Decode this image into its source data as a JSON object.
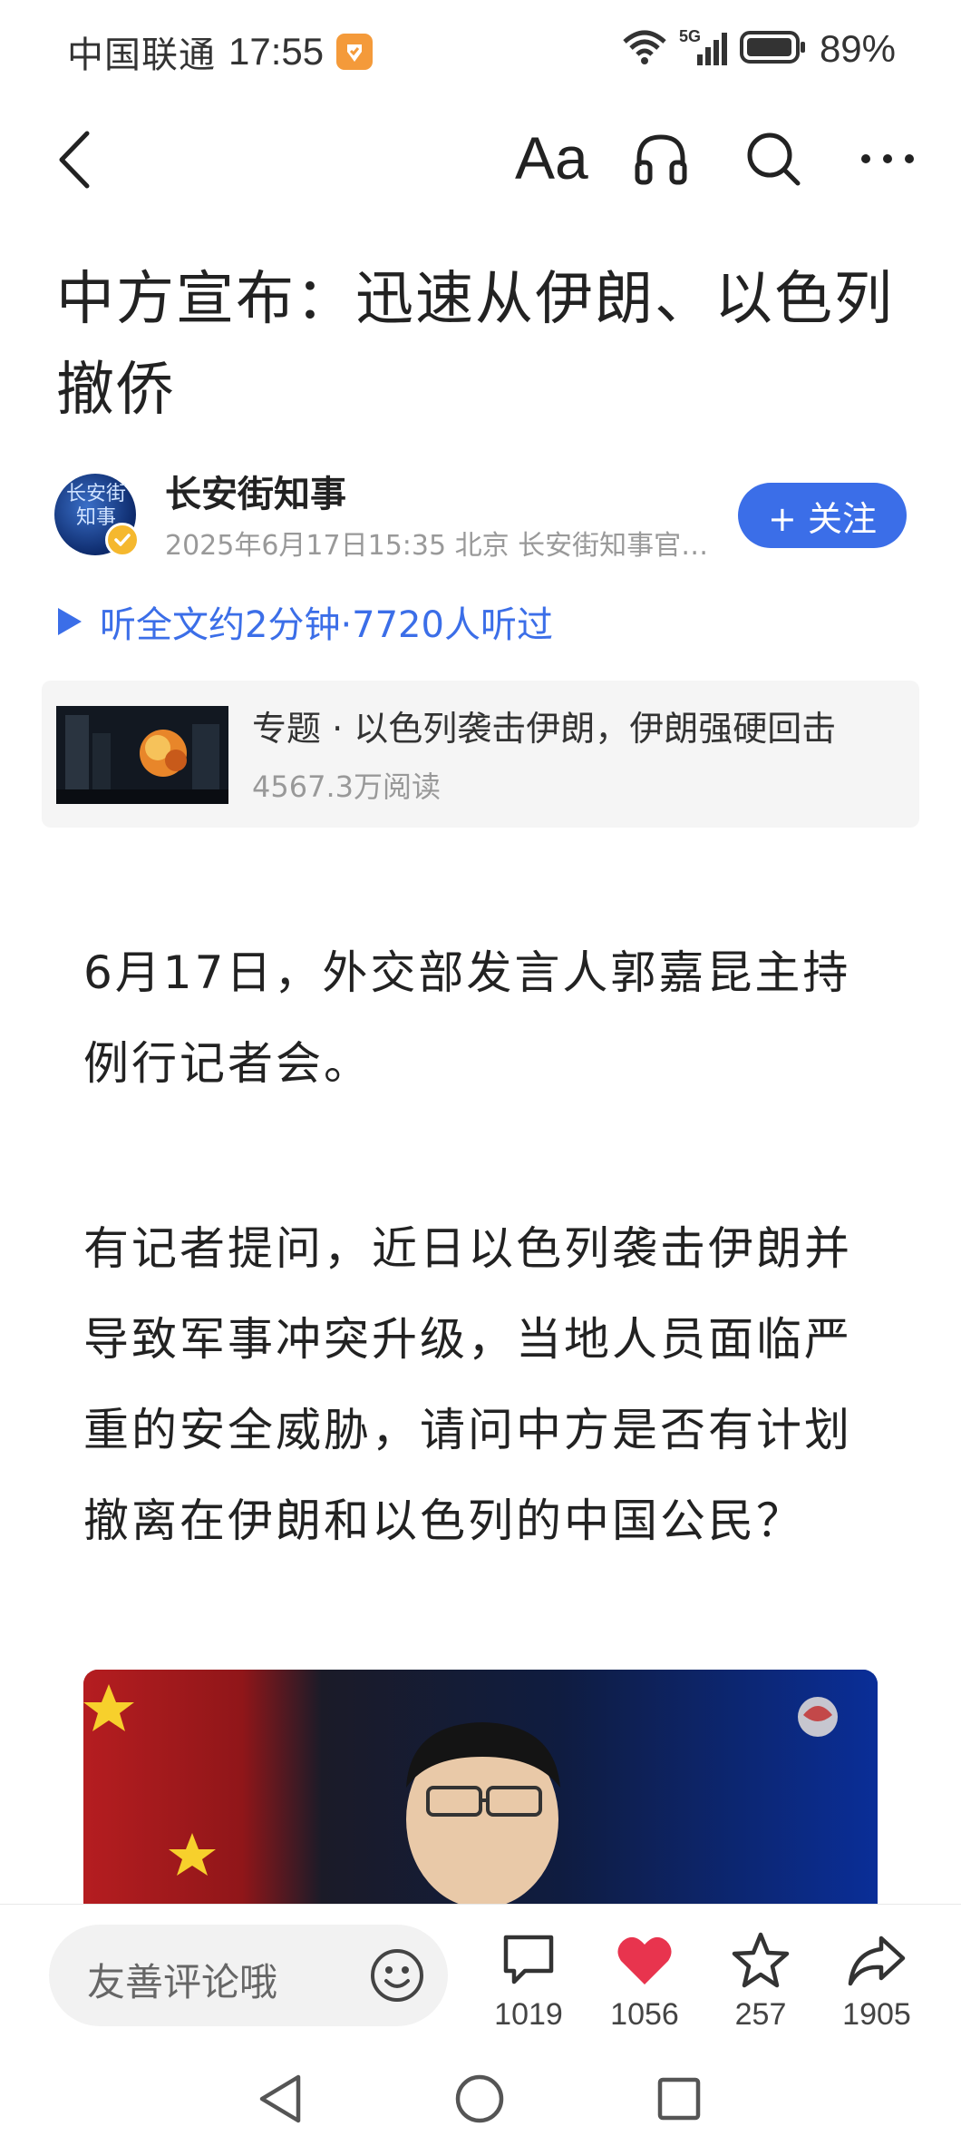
{
  "status_bar": {
    "carrier": "中国联通",
    "time": "17:55",
    "network": "5G",
    "battery": "89%"
  },
  "nav": {
    "font_label": "Aa",
    "icons": [
      "back-icon",
      "font-size-icon",
      "headphones-icon",
      "search-icon",
      "more-icon"
    ]
  },
  "article": {
    "title": "中方宣布：迅速从伊朗、以色列撤侨",
    "author": {
      "name": "长安街知事",
      "avatar_text": "长安街知事",
      "meta": "2025年6月17日15:35 北京 长安街知事官…",
      "follow_label": "+ 关注"
    },
    "listen_label": "听全文约2分钟·7720人听过",
    "topic": {
      "title": "专题 · 以色列袭击伊朗，伊朗强硬回击",
      "reads": "4567.3万阅读"
    },
    "paragraphs": [
      "6月17日，外交部发言人郭嘉昆主持例行记者会。",
      "有记者提问，近日以色列袭击伊朗并导致军事冲突升级，当地人员面临严重的安全威胁，请问中方是否有计划撤离在伊朗和以色列的中国公民？"
    ]
  },
  "action_bar": {
    "comment_placeholder": "友善评论哦",
    "comments": "1019",
    "likes": "1056",
    "favorites": "257",
    "shares": "1905"
  },
  "colors": {
    "accent": "#3b6ee8",
    "like": "#e8344e",
    "verify": "#f5b82e"
  }
}
